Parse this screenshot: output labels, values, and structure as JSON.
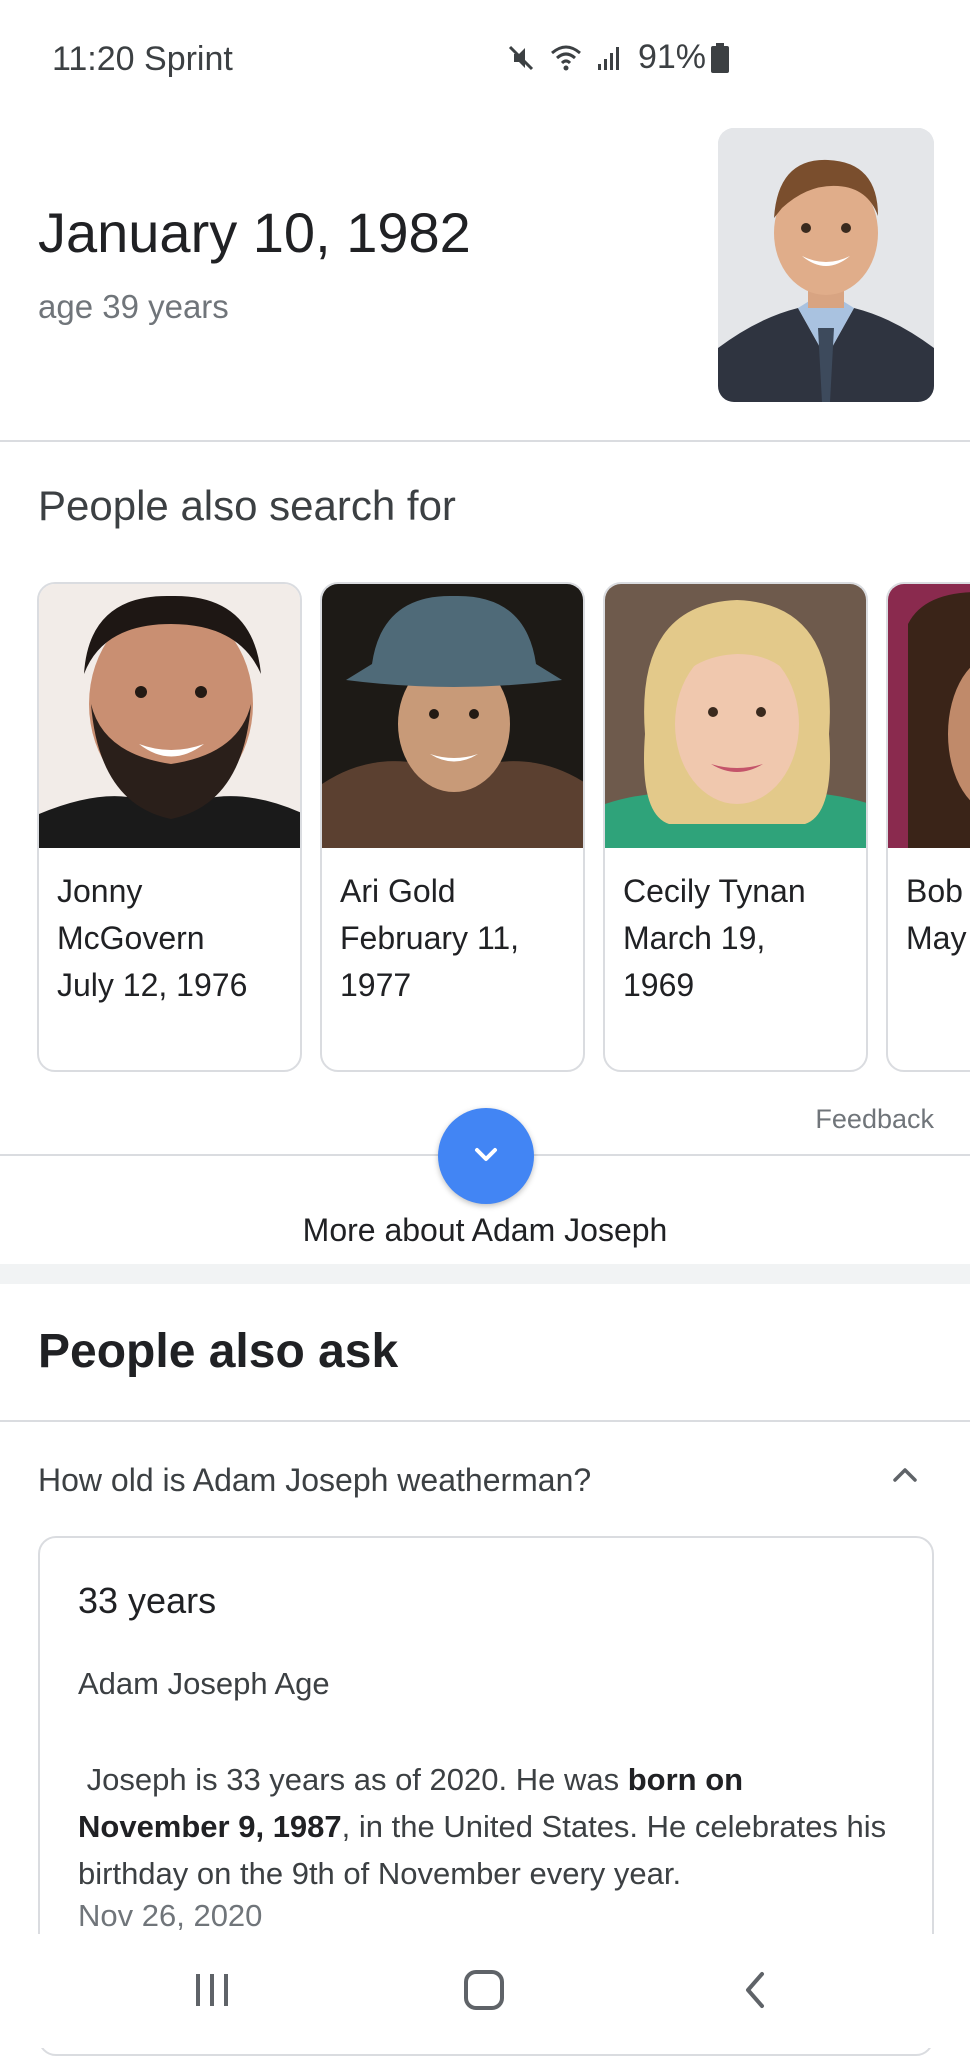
{
  "status_bar": {
    "time": "11:20",
    "carrier": "Sprint",
    "battery": "91%",
    "icons": [
      "mute-icon",
      "wifi-icon",
      "signal-icon",
      "battery-icon"
    ]
  },
  "header": {
    "birth_date": "January 10, 1982",
    "age": "age 39 years"
  },
  "people_also_search_for": {
    "title": "People also search for",
    "cards": [
      {
        "line1": "Jonny",
        "line2": "McGovern",
        "line3": "July 12, 1976"
      },
      {
        "line1": "Ari Gold",
        "line2": "February 11,",
        "line3": "1977"
      },
      {
        "line1": "Cecily Tynan",
        "line2": "March 19,",
        "line3": "1969"
      },
      {
        "line1": "Bob",
        "line2": "May",
        "line3": ""
      }
    ],
    "feedback": "Feedback"
  },
  "more_about": {
    "label": "More about Adam Joseph"
  },
  "people_also_ask": {
    "title": "People also ask",
    "question": "How old is Adam Joseph weatherman?",
    "answer": {
      "headline": "33 years",
      "subtitle": "Adam Joseph Age",
      "body_part1": " Joseph is 33 years as of 2020. He was ",
      "body_bold": "born on November 9, 1987",
      "body_part2": ", in the United States. He celebrates his birthday on the 9th of November every year.",
      "date": "Nov 26, 2020"
    }
  },
  "navigation": {
    "icons": [
      "recent-apps-icon",
      "home-icon",
      "back-icon"
    ]
  }
}
